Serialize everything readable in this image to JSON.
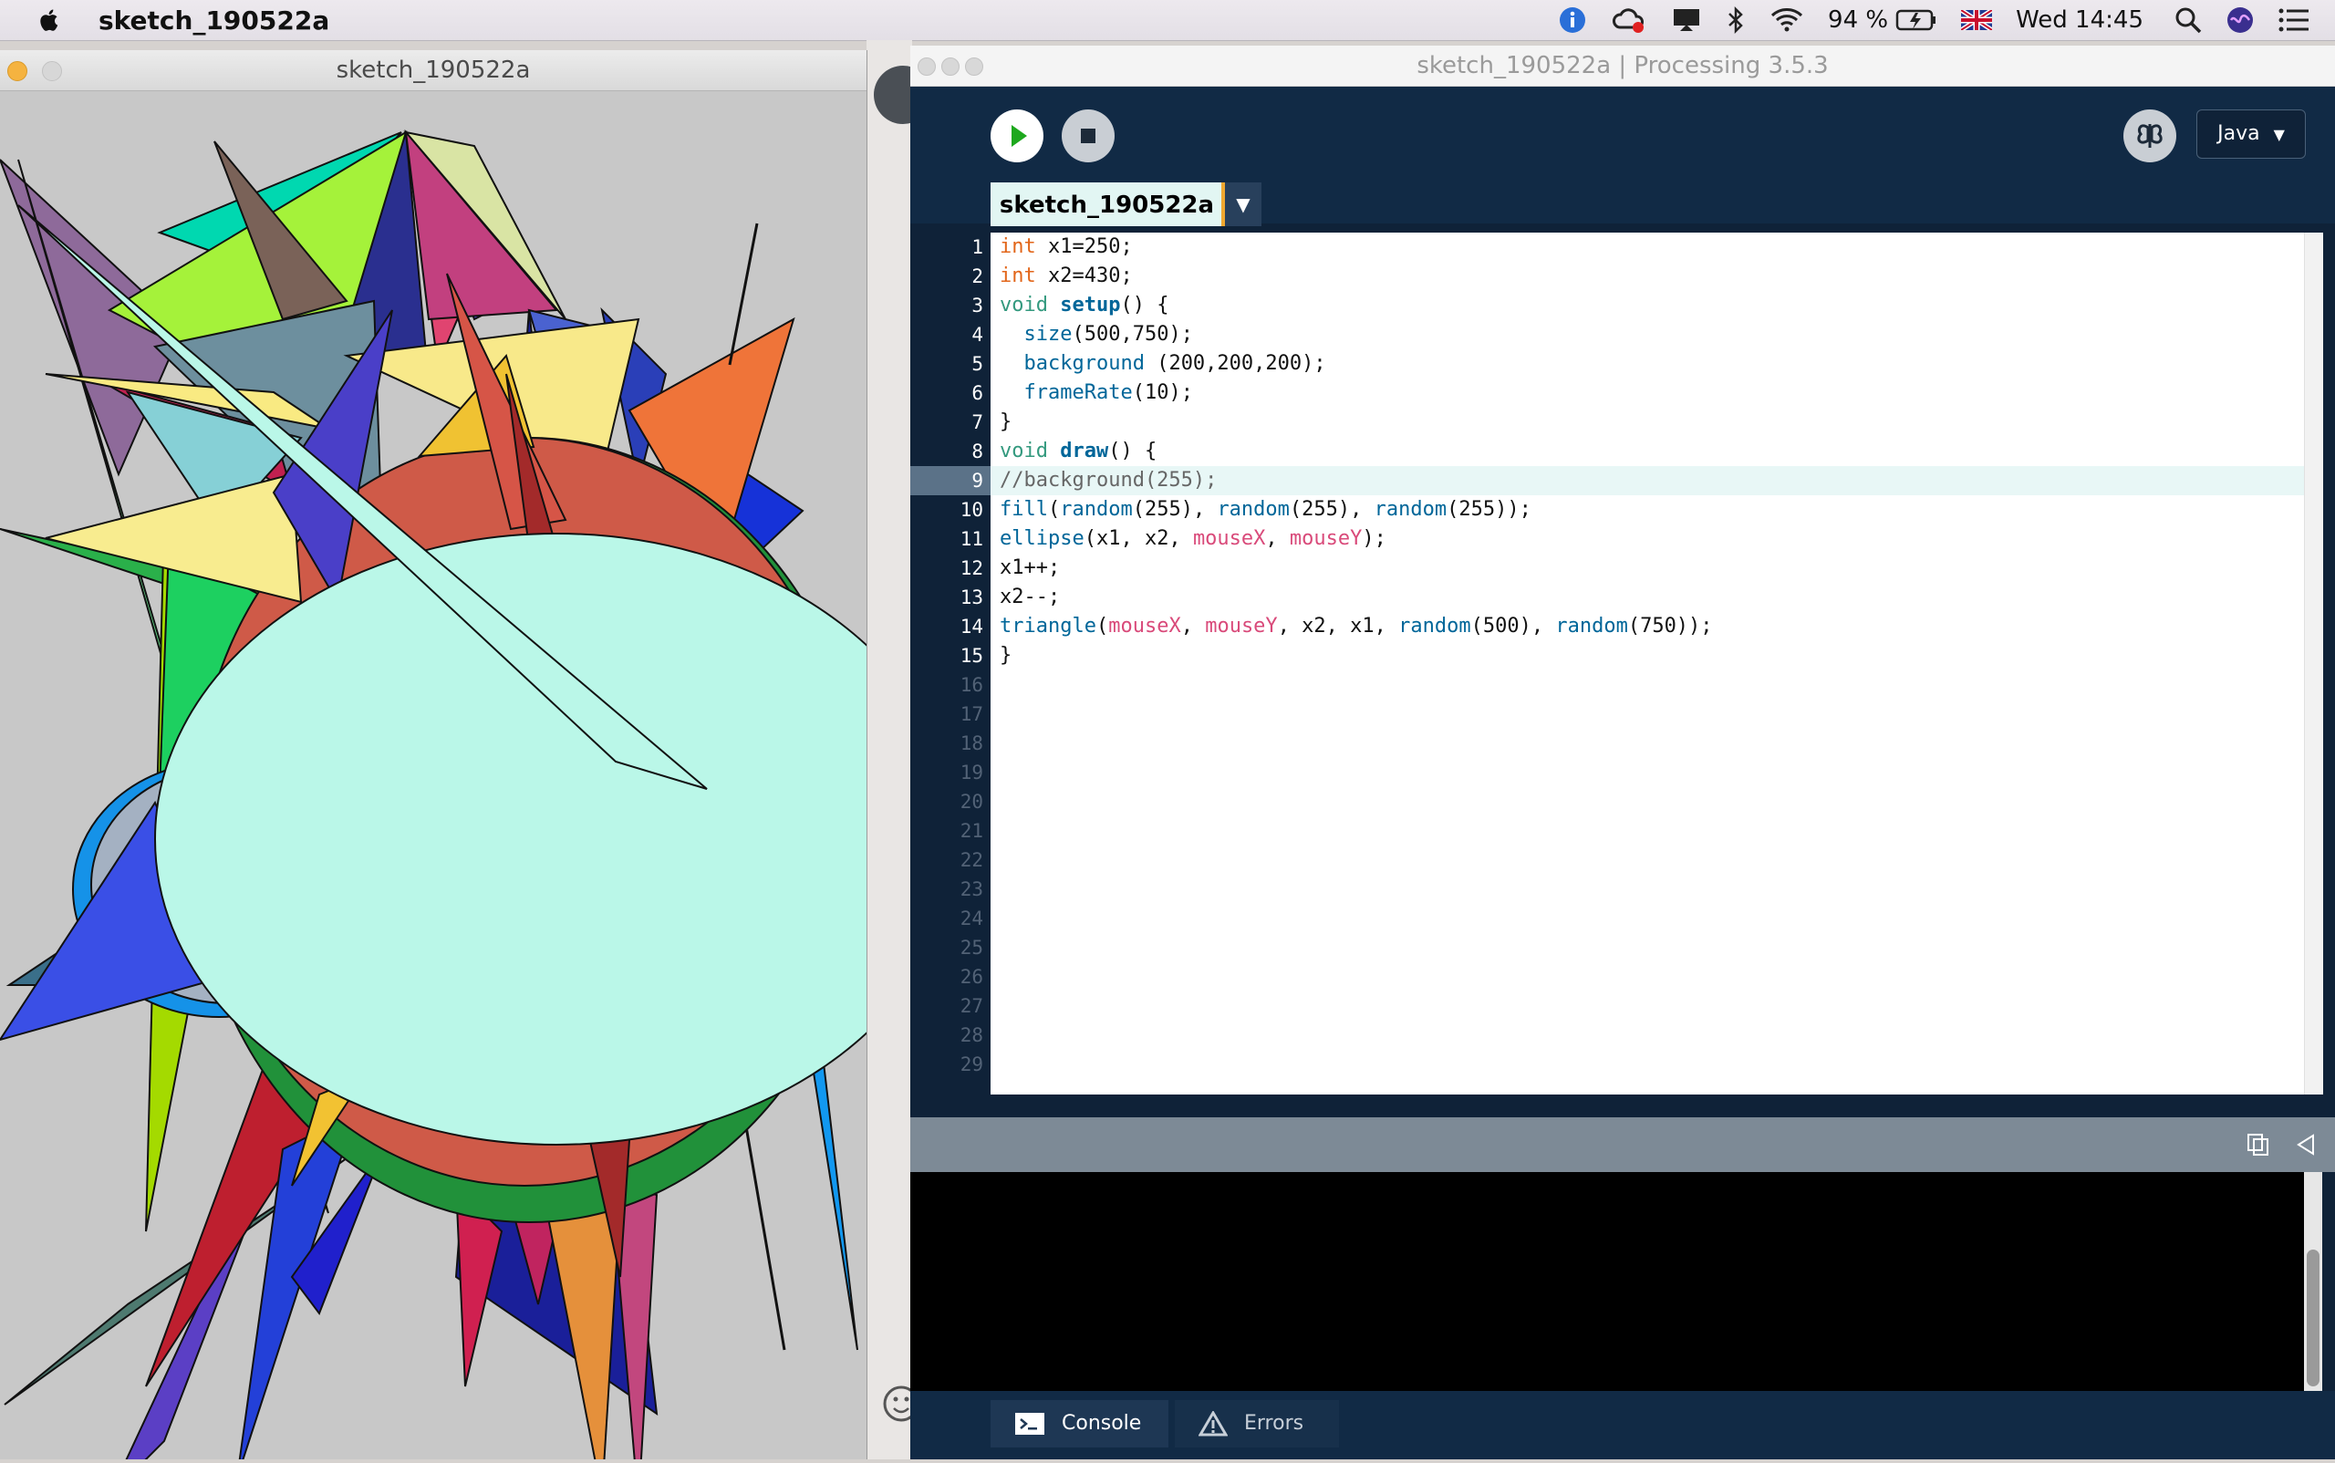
{
  "menubar": {
    "app_name": "sketch_190522a",
    "battery": "94 %",
    "clock": "Wed 14:45"
  },
  "sketch_window": {
    "title": "sketch_190522a"
  },
  "ide": {
    "window_title": "sketch_190522a | Processing 3.5.3",
    "mode": "Java",
    "tab_label": "sketch_190522a",
    "tab_menu_glyph": "▼",
    "line_numbers": [
      "1",
      "2",
      "3",
      "4",
      "5",
      "6",
      "7",
      "8",
      "9",
      "10",
      "11",
      "12",
      "13",
      "14",
      "15",
      "16",
      "17",
      "18",
      "19",
      "20",
      "21",
      "22",
      "23",
      "24",
      "25",
      "26",
      "27",
      "28",
      "29"
    ],
    "active_line": 9,
    "code": [
      "int x1=250;",
      "int x2=430;",
      "void setup() {",
      "  size(500,750);",
      "  background (200,200,200);",
      "  frameRate(10);",
      "}",
      "void draw() {",
      "//background(255);",
      "fill(random(255), random(255), random(255));",
      "ellipse(x1, x2, mouseX, mouseY);",
      "x1++;",
      "x2--;",
      "triangle(mouseX, mouseY, x2, x1, random(500), random(750));",
      "}"
    ],
    "console_tab": "Console",
    "errors_tab": "Errors"
  },
  "colors": {
    "ide_background": "#0f2238",
    "editor_background": "#ffffff",
    "sketch_background": "#c8c8c8",
    "keyword_orange": "#e2661a",
    "function_blue": "#006699",
    "mouse_pink": "#d94a7a"
  },
  "icons": {
    "apple": "apple-logo-icon",
    "run": "play-icon",
    "stop": "stop-icon",
    "debug": "butterfly-debug-icon",
    "console": "terminal-icon",
    "errors": "warning-icon"
  }
}
